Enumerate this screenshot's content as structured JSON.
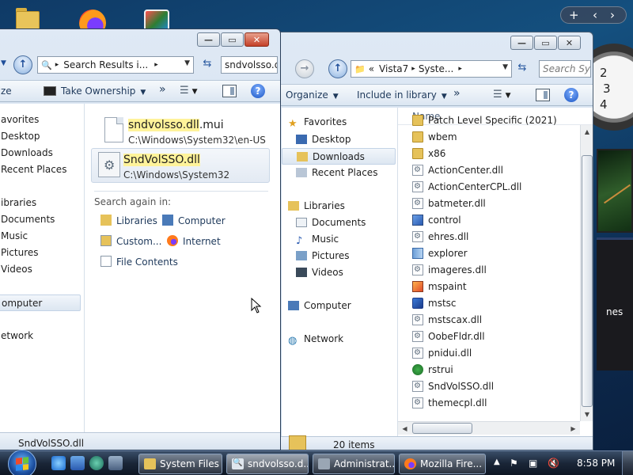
{
  "desktop": {
    "icons": [
      "folder-icon",
      "firefox-icon",
      "app-icon"
    ],
    "gadget_bar": {
      "add": "+",
      "prev": "‹",
      "next": "›"
    },
    "clock_numbers": [
      "2",
      "3",
      "4"
    ],
    "news_text": "nes"
  },
  "search_window": {
    "address": "Search Results i...",
    "search_value": "sndvolsso.d",
    "toolbar": {
      "partial_label": "ze",
      "take_ownership": "Take Ownership",
      "more": "»"
    },
    "nav_items": [
      "avorites",
      "Desktop",
      "Downloads",
      "Recent Places",
      "ibraries",
      "Documents",
      "Music",
      "Pictures",
      "Videos",
      "omputer",
      "etwork"
    ],
    "results": [
      {
        "name_highlight": "sndvolsso.dll",
        "name_rest": ".mui",
        "path": "C:\\Windows\\System32\\en-US"
      },
      {
        "name_highlight": "SndVolSSO.dll",
        "name_rest": "",
        "path": "C:\\Windows\\System32"
      }
    ],
    "search_again_label": "Search again in:",
    "search_again": [
      "Libraries",
      "Computer",
      "Custom...",
      "Internet",
      "File Contents"
    ],
    "details_name": "SndVolSSO.dll"
  },
  "explorer_window": {
    "address": {
      "chevron": "«",
      "part1": "Vista7",
      "part2": "Syste..."
    },
    "search_placeholder": "Search Syst",
    "toolbar": {
      "organize": "Organize",
      "include": "Include in library",
      "more": "»"
    },
    "nav_items": [
      "Favorites",
      "Desktop",
      "Downloads",
      "Recent Places",
      "Libraries",
      "Documents",
      "Music",
      "Pictures",
      "Videos",
      "Computer",
      "Network"
    ],
    "column_header": "Name",
    "files": [
      {
        "name": "Patch Level Specific (2021)",
        "icon": "folder-icon"
      },
      {
        "name": "wbem",
        "icon": "folder-icon"
      },
      {
        "name": "x86",
        "icon": "folder-icon"
      },
      {
        "name": "ActionCenter.dll",
        "icon": "dll-icon"
      },
      {
        "name": "ActionCenterCPL.dll",
        "icon": "dll-icon"
      },
      {
        "name": "batmeter.dll",
        "icon": "dll-icon"
      },
      {
        "name": "control",
        "icon": "control-panel-icon"
      },
      {
        "name": "ehres.dll",
        "icon": "dll-icon"
      },
      {
        "name": "explorer",
        "icon": "explorer-icon"
      },
      {
        "name": "imageres.dll",
        "icon": "dll-icon"
      },
      {
        "name": "mspaint",
        "icon": "paint-icon"
      },
      {
        "name": "mstsc",
        "icon": "remote-desktop-icon"
      },
      {
        "name": "mstscax.dll",
        "icon": "dll-icon"
      },
      {
        "name": "OobeFldr.dll",
        "icon": "dll-icon"
      },
      {
        "name": "pnidui.dll",
        "icon": "dll-icon"
      },
      {
        "name": "rstrui",
        "icon": "system-restore-icon"
      },
      {
        "name": "SndVolSSO.dll",
        "icon": "dll-icon"
      },
      {
        "name": "themecpl.dll",
        "icon": "dll-icon"
      }
    ],
    "status": "20 items"
  },
  "taskbar": {
    "buttons": [
      "System Files",
      "sndvolsso.d...",
      "Administrat...",
      "Mozilla Fire..."
    ],
    "time": "8:58 PM"
  },
  "colors": {
    "accent": "#1e395b",
    "highlight": "#fff39a",
    "selection": "#dce6f1"
  }
}
